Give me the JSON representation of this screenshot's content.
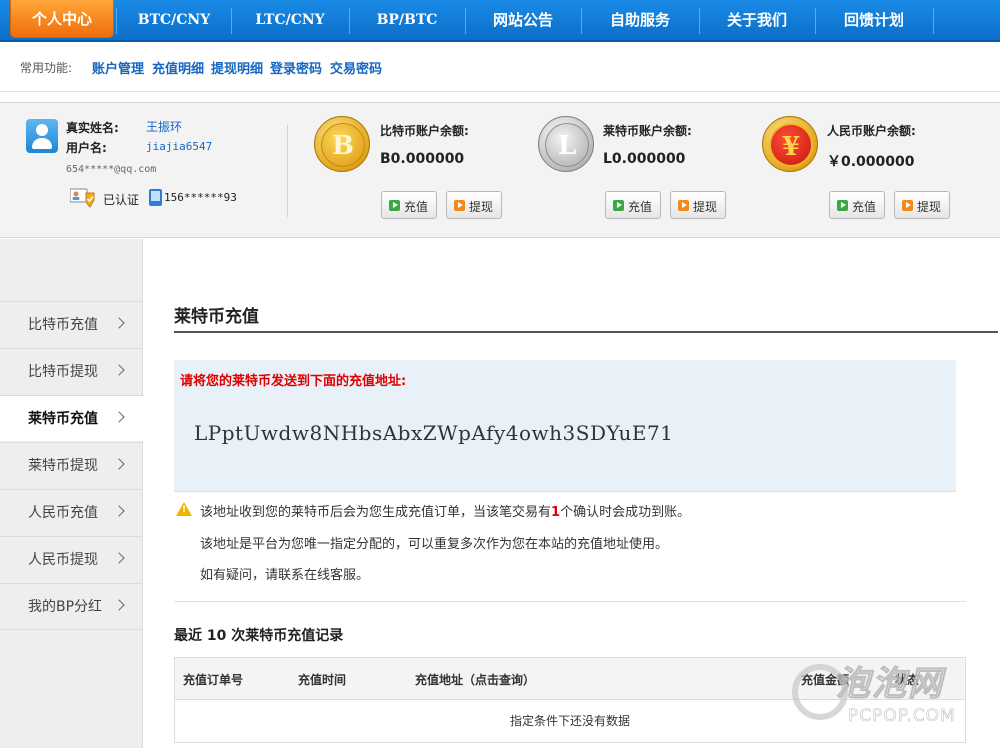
{
  "nav": {
    "active": "个人中心",
    "items": [
      "BTC/CNY",
      "LTC/CNY",
      "BP/BTC",
      "网站公告",
      "自助服务",
      "关于我们",
      "回馈计划"
    ]
  },
  "common": {
    "label": "常用功能:",
    "links": [
      "账户管理",
      "充值明细",
      "提现明细",
      "登录密码",
      "交易密码"
    ]
  },
  "user": {
    "real_name_label": "真实姓名:",
    "real_name": "王振环",
    "username_label": "用户名:",
    "username": "jiajia6547",
    "email": "654*****@qq.com",
    "verified": "已认证",
    "phone": "156******93"
  },
  "balances": [
    {
      "label": "比特币账户余额:",
      "value": "B0.000000",
      "deposit": "充值",
      "withdraw": "提现",
      "icon": "bitcoin-coin-icon",
      "symbol": "B"
    },
    {
      "label": "莱特币账户余额:",
      "value": "L0.000000",
      "deposit": "充值",
      "withdraw": "提现",
      "icon": "litecoin-coin-icon",
      "symbol": "L"
    },
    {
      "label": "人民币账户余额:",
      "value": "￥0.000000",
      "deposit": "充值",
      "withdraw": "提现",
      "icon": "yuan-coin-icon",
      "symbol": "¥"
    }
  ],
  "sidebar": {
    "items": [
      "比特币充值",
      "比特币提现",
      "莱特币充值",
      "莱特币提现",
      "人民币充值",
      "人民币提现",
      "我的BP分红"
    ],
    "active_index": 2
  },
  "main": {
    "title": "莱特币充值",
    "prompt": "请将您的莱特币发送到下面的充值地址:",
    "address": "LPptUwdw8NHbsAbxZWpAfy4owh3SDYuE71",
    "note1_a": "该地址收到您的莱特币后会为您生成充值订单，当该笔交易有",
    "note1_num": "1",
    "note1_b": "个确认时会成功到账。",
    "note2": "该地址是平台为您唯一指定分配的，可以重复多次作为您在本站的充值地址使用。",
    "note3": "如有疑问，请联系在线客服。",
    "records_title": "最近 10 次莱特币充值记录",
    "columns": [
      "充值订单号",
      "充值时间",
      "充值地址（点击查询）",
      "充值金额",
      "状态"
    ],
    "empty": "指定条件下还没有数据"
  },
  "watermark": {
    "text": "泡泡网",
    "sub": "PCPOP.COM"
  },
  "colors": {
    "nav_blue": "#0b6fc8",
    "nav_active": "#f06d0a",
    "link_blue": "#1466c2",
    "alert_red": "#e00000"
  }
}
